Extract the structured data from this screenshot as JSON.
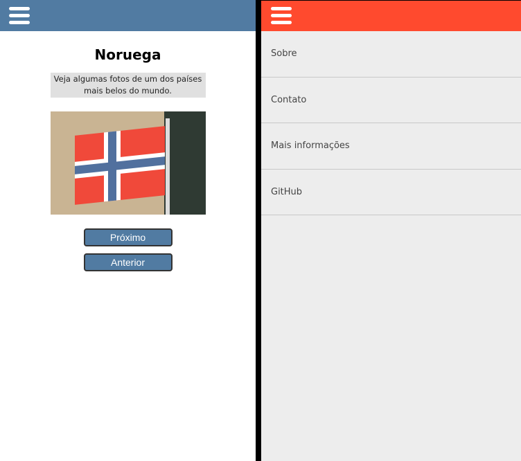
{
  "main": {
    "title": "Noruega",
    "description": "Veja algumas fotos de um dos países mais belos do mundo.",
    "next_label": "Próximo",
    "prev_label": "Anterior",
    "header_color": "#517ba2"
  },
  "menu": {
    "header_color": "#ff4a2e",
    "items": [
      {
        "label": "Sobre"
      },
      {
        "label": "Contato"
      },
      {
        "label": "Mais informações"
      },
      {
        "label": "GitHub"
      }
    ]
  }
}
